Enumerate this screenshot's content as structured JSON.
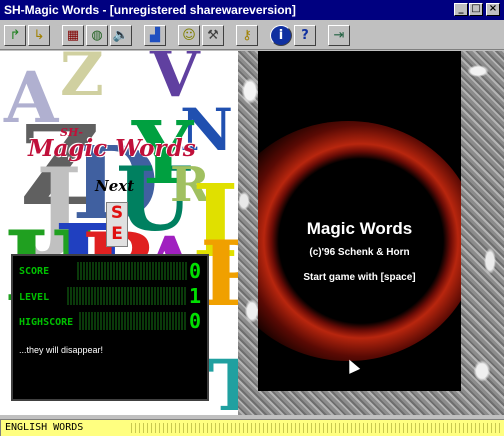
{
  "window": {
    "title": "SH-Magic Words - [unregistered sharewareversion]",
    "controls": {
      "minimize": "_",
      "maximize": "□",
      "close": "×"
    }
  },
  "toolbar": {
    "buttons": [
      {
        "name": "arrow-green-icon",
        "glyph": "↱"
      },
      {
        "name": "arrow-yellow-icon",
        "glyph": "↳"
      },
      {
        "name": "grid-icon",
        "glyph": "▦"
      },
      {
        "name": "globe-icon",
        "glyph": "◍"
      },
      {
        "name": "speaker-icon",
        "glyph": "🔈"
      },
      {
        "name": "podium-icon",
        "glyph": "▟"
      },
      {
        "name": "sh-figure-icon",
        "glyph": "☺"
      },
      {
        "name": "hammer-icon",
        "glyph": "⚒"
      },
      {
        "name": "key-icon",
        "glyph": "⚷"
      },
      {
        "name": "info-icon",
        "glyph": "i"
      },
      {
        "name": "help-icon",
        "glyph": "?"
      },
      {
        "name": "exit-icon",
        "glyph": "⇥"
      }
    ]
  },
  "left": {
    "logo_prefix": "SH-",
    "logo_title": "Magic Words",
    "next_label": "Next",
    "next_letters": [
      "S",
      "E"
    ]
  },
  "stats": {
    "score_label": "SCORE",
    "score_value": "0",
    "level_label": "LEVEL",
    "level_value": "1",
    "highscore_label": "HIGHSCORE",
    "highscore_value": "0",
    "message": "...they will disappear!"
  },
  "game": {
    "title": "Magic Words",
    "copyright": "(c)'96 Schenk & Horn",
    "start_hint": "Start game with [space]"
  },
  "status": {
    "text": "ENGLISH WORDS"
  },
  "colors": {
    "titlebar": "#000080",
    "logo": "#c0103a",
    "lcd_green": "#00e000",
    "status_yellow": "#ffff80"
  }
}
